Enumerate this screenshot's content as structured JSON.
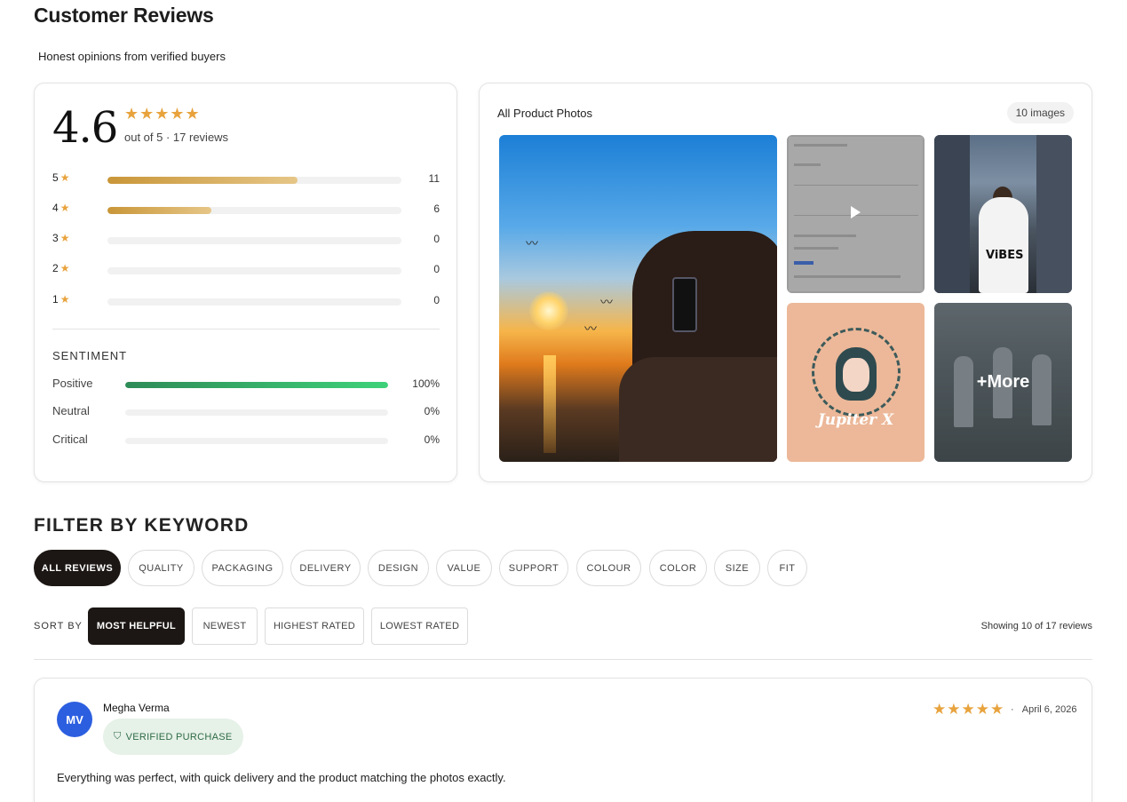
{
  "header": {
    "title": "Customer Reviews",
    "subtitle": "Honest opinions from verified buyers"
  },
  "summary": {
    "average": "4.6",
    "stars": "★★★★★",
    "caption": "out of 5 · 17 reviews",
    "star_glyph": "★",
    "distribution": [
      {
        "stars": "5",
        "count": "11",
        "fraction": 0.647
      },
      {
        "stars": "4",
        "count": "6",
        "fraction": 0.353
      },
      {
        "stars": "3",
        "count": "0",
        "fraction": 0
      },
      {
        "stars": "2",
        "count": "0",
        "fraction": 0
      },
      {
        "stars": "1",
        "count": "0",
        "fraction": 0
      }
    ],
    "sentiment": {
      "heading": "SENTIMENT",
      "rows": [
        {
          "label": "Positive",
          "percent": "100%",
          "fraction": 1.0
        },
        {
          "label": "Neutral",
          "percent": "0%",
          "fraction": 0
        },
        {
          "label": "Critical",
          "percent": "0%",
          "fraction": 0
        }
      ]
    }
  },
  "photos": {
    "title": "All Product Photos",
    "count_badge": "10 images",
    "more_label": "+More",
    "city_shirt_text": "ViBES",
    "logo_text": "Jupiter X"
  },
  "filters": {
    "heading": "FILTER BY KEYWORD",
    "chips": [
      "ALL REVIEWS",
      "QUALITY",
      "PACKAGING",
      "DELIVERY",
      "DESIGN",
      "VALUE",
      "SUPPORT",
      "COLOUR",
      "COLOR",
      "SIZE",
      "FIT"
    ],
    "active": "ALL REVIEWS"
  },
  "sort": {
    "label": "SORT BY",
    "options": [
      "MOST HELPFUL",
      "NEWEST",
      "HIGHEST RATED",
      "LOWEST RATED"
    ],
    "active": "MOST HELPFUL",
    "showing": "Showing 10 of 17 reviews"
  },
  "reviews": [
    {
      "initials": "MV",
      "name": "Megha Verma",
      "badge": "VERIFIED PURCHASE",
      "stars": "★★★★★",
      "date_sep": "·",
      "date": "April 6, 2026",
      "text": "Everything was perfect, with quick delivery and the product matching the photos exactly."
    }
  ],
  "colors": {
    "star": "#e8a33d",
    "dist_bar": "#c99638",
    "positive_bar": "#2e8b57",
    "active_chip": "#1c1714",
    "avatar": "#2c5fe0",
    "verified_bg": "#e6f1e8"
  }
}
